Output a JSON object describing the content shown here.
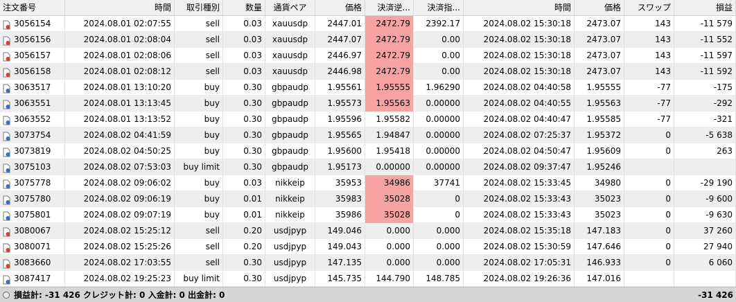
{
  "columns": [
    {
      "key": "order",
      "label": "注文番号",
      "w": 94,
      "align": "l"
    },
    {
      "key": "time",
      "label": "時間",
      "w": 158,
      "align": "r"
    },
    {
      "key": "type",
      "label": "取引種別",
      "w": 70,
      "align": "r"
    },
    {
      "key": "volume",
      "label": "数量",
      "w": 61,
      "align": "r"
    },
    {
      "key": "symbol",
      "label": "通貨ペア",
      "w": 72,
      "align": "ctr"
    },
    {
      "key": "price",
      "label": "価格",
      "w": 72,
      "align": "r"
    },
    {
      "key": "sl",
      "label": "決済逆...",
      "w": 70,
      "align": "r"
    },
    {
      "key": "tp",
      "label": "決済指...",
      "w": 72,
      "align": "r"
    },
    {
      "key": "time2",
      "label": "時間",
      "w": 160,
      "align": "r"
    },
    {
      "key": "price2",
      "label": "価格",
      "w": 72,
      "align": "r"
    },
    {
      "key": "swap",
      "label": "スワップ",
      "w": 72,
      "align": "r"
    },
    {
      "key": "profit",
      "label": "損益",
      "w": 89,
      "align": "r"
    }
  ],
  "rows": [
    {
      "order": "3056154",
      "time": "2024.08.01 02:07:55",
      "type": "sell",
      "volume": "0.03",
      "symbol": "xauusdp",
      "price": "2447.01",
      "sl": "2472.79",
      "tp": "2392.17",
      "time2": "2024.08.02 15:30:18",
      "price2": "2473.07",
      "swap": "143",
      "profit": "-11 579",
      "hl": true,
      "dir": "sell"
    },
    {
      "order": "3056156",
      "time": "2024.08.01 02:08:04",
      "type": "sell",
      "volume": "0.03",
      "symbol": "xauusdp",
      "price": "2447.07",
      "sl": "2472.79",
      "tp": "0.00",
      "time2": "2024.08.02 15:30:18",
      "price2": "2473.07",
      "swap": "143",
      "profit": "-11 552",
      "hl": true,
      "dir": "sell"
    },
    {
      "order": "3056157",
      "time": "2024.08.01 02:08:06",
      "type": "sell",
      "volume": "0.03",
      "symbol": "xauusdp",
      "price": "2446.97",
      "sl": "2472.79",
      "tp": "0.00",
      "time2": "2024.08.02 15:30:18",
      "price2": "2473.07",
      "swap": "143",
      "profit": "-11 597",
      "hl": true,
      "dir": "sell"
    },
    {
      "order": "3056158",
      "time": "2024.08.01 02:08:12",
      "type": "sell",
      "volume": "0.03",
      "symbol": "xauusdp",
      "price": "2446.98",
      "sl": "2472.79",
      "tp": "0.00",
      "time2": "2024.08.02 15:30:18",
      "price2": "2473.07",
      "swap": "143",
      "profit": "-11 592",
      "hl": true,
      "dir": "sell"
    },
    {
      "order": "3063517",
      "time": "2024.08.01 13:10:20",
      "type": "buy",
      "volume": "0.30",
      "symbol": "gbpaudp",
      "price": "1.95561",
      "sl": "1.95555",
      "tp": "1.96290",
      "time2": "2024.08.02 04:40:58",
      "price2": "1.95555",
      "swap": "-77",
      "profit": "-175",
      "hl": true,
      "dir": "buy"
    },
    {
      "order": "3063551",
      "time": "2024.08.01 13:13:45",
      "type": "buy",
      "volume": "0.30",
      "symbol": "gbpaudp",
      "price": "1.95573",
      "sl": "1.95563",
      "tp": "0.00000",
      "time2": "2024.08.02 04:40:55",
      "price2": "1.95563",
      "swap": "-77",
      "profit": "-292",
      "hl": true,
      "dir": "buy"
    },
    {
      "order": "3063552",
      "time": "2024.08.01 13:13:52",
      "type": "buy",
      "volume": "0.30",
      "symbol": "gbpaudp",
      "price": "1.95596",
      "sl": "1.95582",
      "tp": "0.00000",
      "time2": "2024.08.02 04:40:47",
      "price2": "1.95585",
      "swap": "-77",
      "profit": "-321",
      "hl": false,
      "dir": "buy"
    },
    {
      "order": "3073754",
      "time": "2024.08.02 04:41:59",
      "type": "buy",
      "volume": "0.30",
      "symbol": "gbpaudp",
      "price": "1.95565",
      "sl": "1.94847",
      "tp": "0.00000",
      "time2": "2024.08.02 07:25:37",
      "price2": "1.95372",
      "swap": "0",
      "profit": "-5 638",
      "hl": false,
      "dir": "buy"
    },
    {
      "order": "3073819",
      "time": "2024.08.02 04:50:25",
      "type": "buy",
      "volume": "0.30",
      "symbol": "gbpaudp",
      "price": "1.95600",
      "sl": "1.95418",
      "tp": "0.00000",
      "time2": "2024.08.02 04:50:47",
      "price2": "1.95609",
      "swap": "0",
      "profit": "263",
      "hl": false,
      "dir": "buy"
    },
    {
      "order": "3075103",
      "time": "2024.08.02 07:53:03",
      "type": "buy limit",
      "volume": "0.30",
      "symbol": "gbpaudp",
      "price": "1.95173",
      "sl": "0.00000",
      "tp": "0.00000",
      "time2": "2024.08.02 09:37:47",
      "price2": "1.95246",
      "swap": "",
      "profit": "",
      "hl": false,
      "dir": "buy"
    },
    {
      "order": "3075778",
      "time": "2024.08.02 09:06:02",
      "type": "buy",
      "volume": "0.03",
      "symbol": "nikkeip",
      "price": "35953",
      "sl": "34986",
      "tp": "37741",
      "time2": "2024.08.02 15:33:45",
      "price2": "34980",
      "swap": "0",
      "profit": "-29 190",
      "hl": true,
      "dir": "buy"
    },
    {
      "order": "3075780",
      "time": "2024.08.02 09:06:19",
      "type": "buy",
      "volume": "0.01",
      "symbol": "nikkeip",
      "price": "35983",
      "sl": "35028",
      "tp": "0",
      "time2": "2024.08.02 15:33:43",
      "price2": "35023",
      "swap": "0",
      "profit": "-9 600",
      "hl": true,
      "dir": "buy"
    },
    {
      "order": "3075801",
      "time": "2024.08.02 09:07:19",
      "type": "buy",
      "volume": "0.01",
      "symbol": "nikkeip",
      "price": "35986",
      "sl": "35028",
      "tp": "0",
      "time2": "2024.08.02 15:33:43",
      "price2": "35023",
      "swap": "0",
      "profit": "-9 630",
      "hl": true,
      "dir": "buy"
    },
    {
      "order": "3080067",
      "time": "2024.08.02 15:25:12",
      "type": "sell",
      "volume": "0.20",
      "symbol": "usdjpyp",
      "price": "149.046",
      "sl": "0.000",
      "tp": "0.000",
      "time2": "2024.08.02 15:35:18",
      "price2": "147.183",
      "swap": "0",
      "profit": "37 260",
      "hl": false,
      "dir": "sell"
    },
    {
      "order": "3080071",
      "time": "2024.08.02 15:25:26",
      "type": "sell",
      "volume": "0.20",
      "symbol": "usdjpyp",
      "price": "149.043",
      "sl": "0.000",
      "tp": "0.000",
      "time2": "2024.08.02 15:30:59",
      "price2": "147.646",
      "swap": "0",
      "profit": "27 940",
      "hl": false,
      "dir": "sell"
    },
    {
      "order": "3083660",
      "time": "2024.08.02 17:03:55",
      "type": "sell",
      "volume": "0.30",
      "symbol": "usdjpyp",
      "price": "147.135",
      "sl": "0.000",
      "tp": "0.000",
      "time2": "2024.08.02 17:05:31",
      "price2": "146.933",
      "swap": "0",
      "profit": "6 060",
      "hl": false,
      "dir": "sell"
    },
    {
      "order": "3087417",
      "time": "2024.08.02 19:25:23",
      "type": "buy limit",
      "volume": "0.30",
      "symbol": "usdjpyp",
      "price": "145.735",
      "sl": "144.790",
      "tp": "148.785",
      "time2": "2024.08.02 19:26:36",
      "price2": "147.016",
      "swap": "",
      "profit": "",
      "hl": false,
      "dir": "buy"
    }
  ],
  "footer": {
    "summary": "損益計: -31 426  クレジット計: 0  入金計: 0  出金計: 0",
    "total": "-31 426"
  },
  "colors": {
    "sl_highlight": "#f7a3a3",
    "sell_icon": "#d9412b",
    "buy_icon": "#2f74c0"
  }
}
